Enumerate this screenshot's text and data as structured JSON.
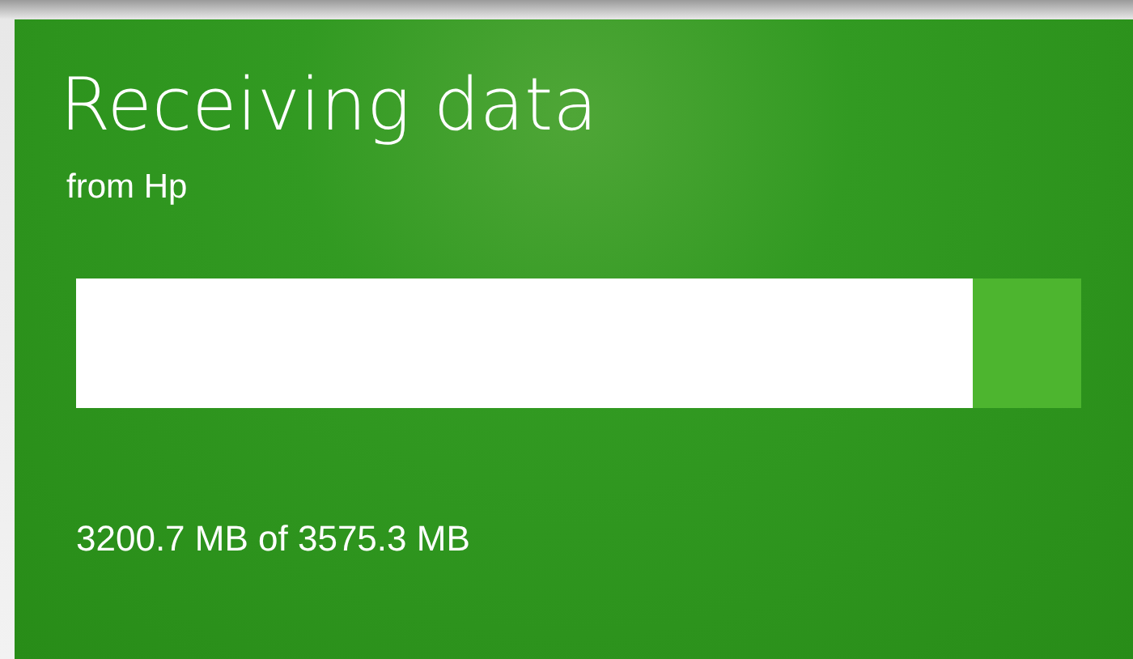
{
  "title": "Receiving data",
  "subtitle": "from Hp",
  "progress": {
    "level": 0.892
  },
  "status": "3200.7 MB of 3575.3 MB"
}
